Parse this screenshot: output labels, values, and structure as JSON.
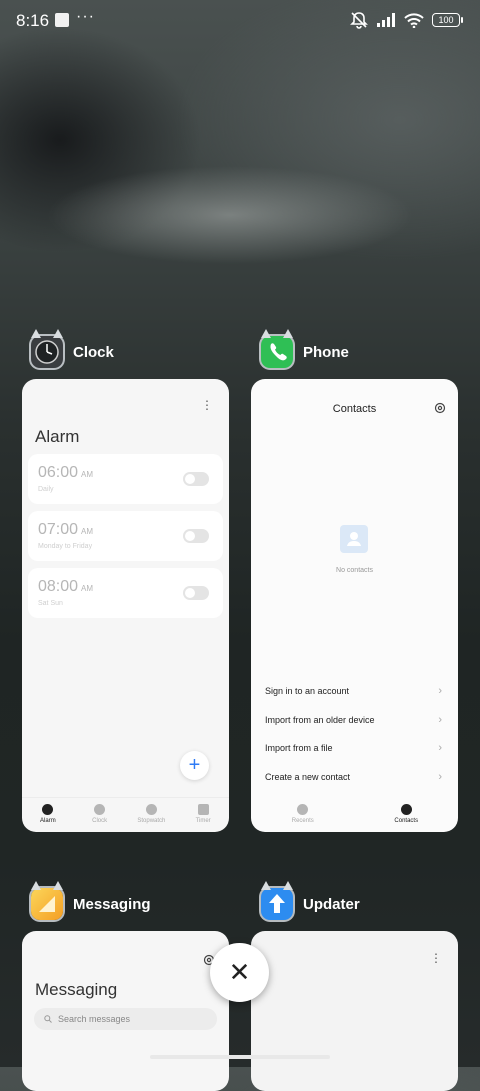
{
  "status_bar": {
    "time": "8:16",
    "overflow": "···",
    "battery": "100",
    "icons": [
      "muted-bell-icon",
      "signal-icon",
      "wifi-icon",
      "battery-icon"
    ]
  },
  "cards": {
    "clock": {
      "app_name": "Clock",
      "title": "Alarm",
      "alarms": [
        {
          "time": "06:00",
          "ampm": "AM",
          "repeat": "Daily"
        },
        {
          "time": "07:00",
          "ampm": "AM",
          "repeat": "Monday to Friday"
        },
        {
          "time": "08:00",
          "ampm": "AM",
          "repeat": "Sat Sun"
        }
      ],
      "add_symbol": "+",
      "tabs": [
        "Alarm",
        "Clock",
        "Stopwatch",
        "Timer"
      ]
    },
    "phone": {
      "app_name": "Phone",
      "title": "Contacts",
      "empty_text": "No contacts",
      "actions": [
        "Sign in to an account",
        "Import from an older device",
        "Import from a file",
        "Create a new contact"
      ],
      "tabs": [
        "Recents",
        "Contacts"
      ]
    },
    "messaging": {
      "app_name": "Messaging",
      "title": "Messaging",
      "search_placeholder": "Search messages"
    },
    "updater": {
      "app_name": "Updater"
    }
  },
  "close_symbol": "✕"
}
